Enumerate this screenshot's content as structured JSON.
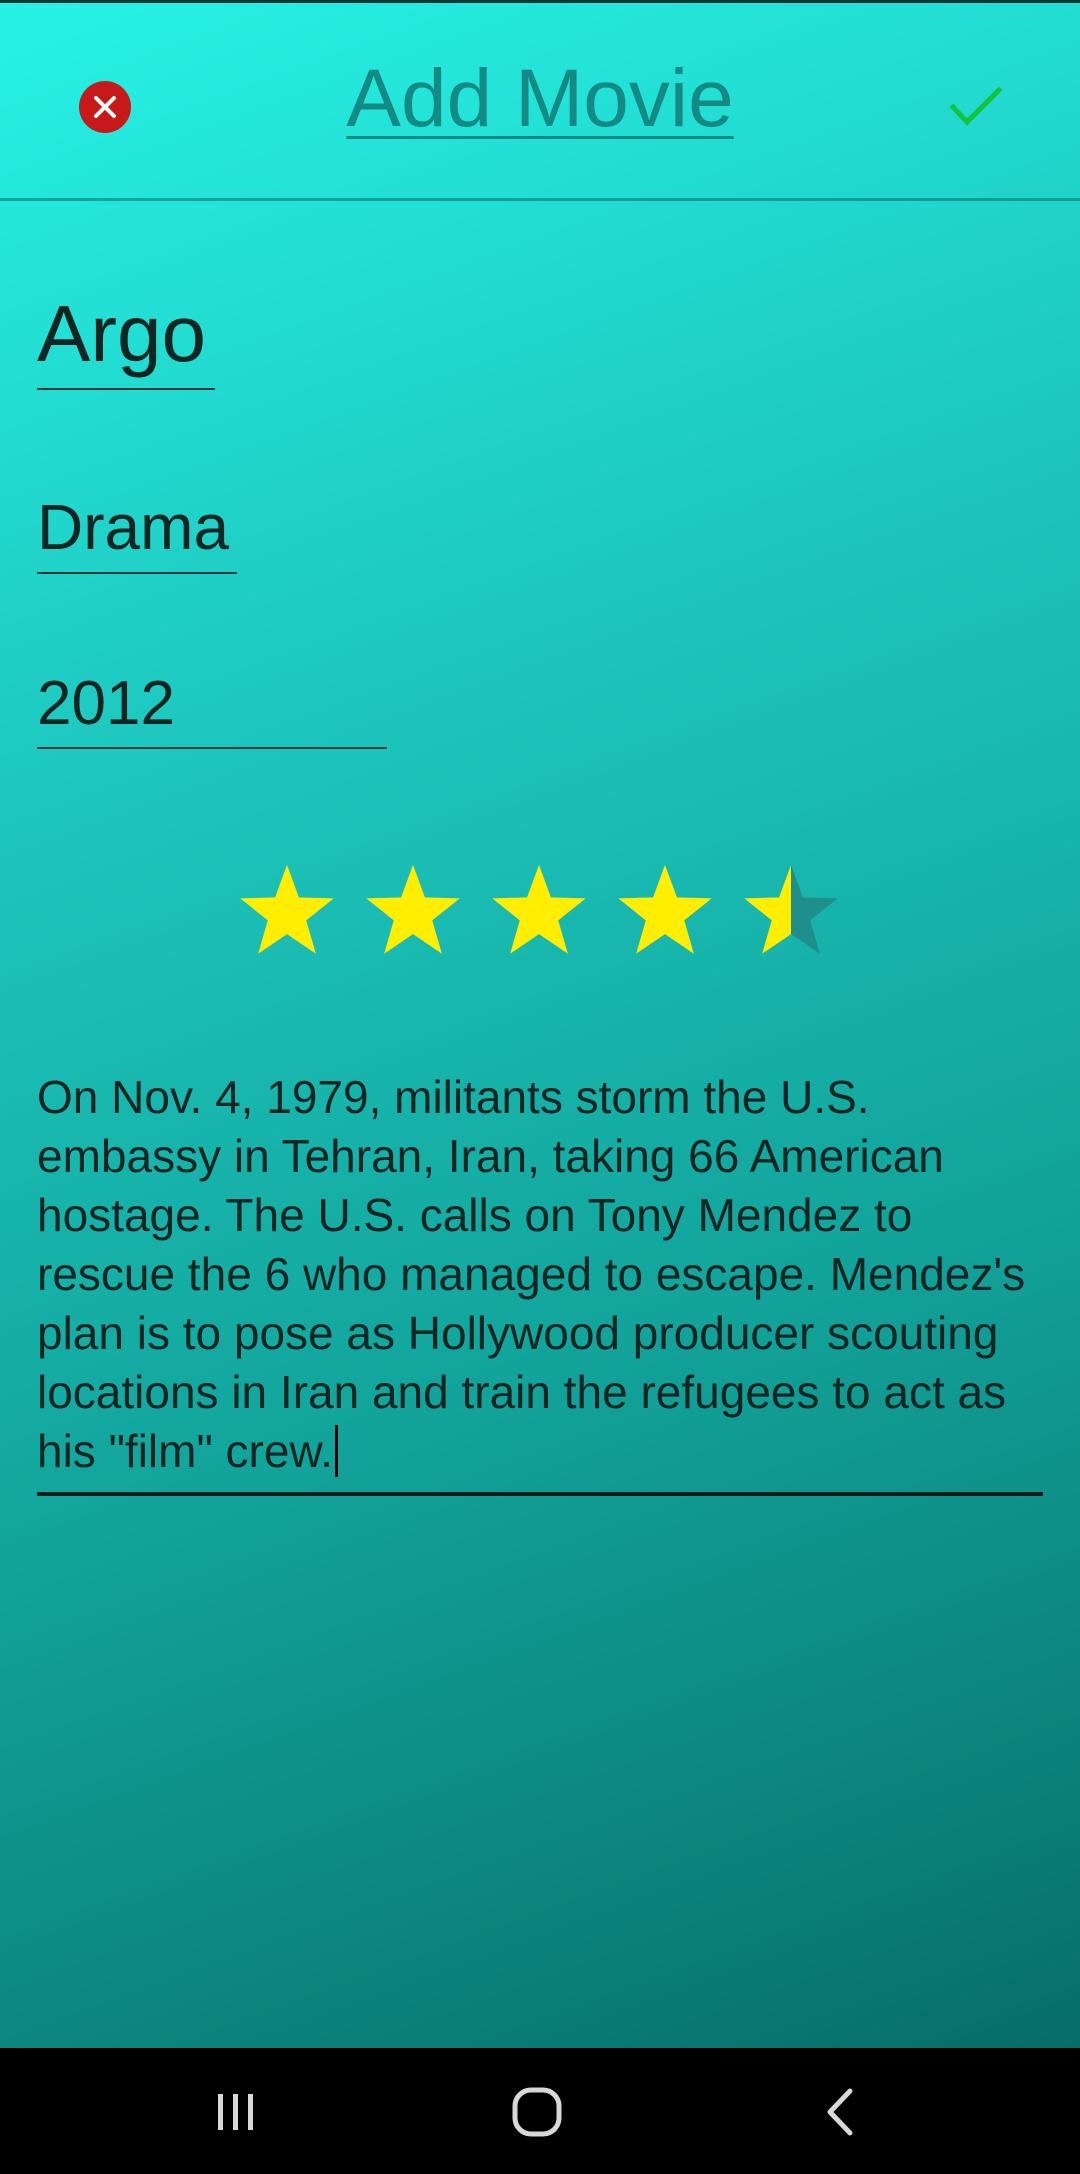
{
  "header": {
    "title": "Add Movie",
    "cancel_icon": "close-circle-icon",
    "confirm_icon": "check-icon"
  },
  "form": {
    "title_value": "Argo",
    "genre_value": "Drama",
    "year_value": "2012",
    "rating": {
      "value": 4.5,
      "max": 5
    },
    "description": "On Nov. 4, 1979, militants storm the U.S. embassy in Tehran, Iran, taking 66 American hostage. The U.S. calls on Tony Mendez to rescue the 6 who managed to escape. Mendez's plan is to pose as Hollywood producer scouting locations in Iran and train the refugees to act as his \"film\" crew."
  },
  "navbar": {
    "recent_icon": "recent-apps-icon",
    "home_icon": "home-icon",
    "back_icon": "back-icon"
  },
  "colors": {
    "star_filled": "#ffee00",
    "star_empty": "#1e8f8a",
    "cancel_red": "#c8191a",
    "confirm_green": "#13c43a",
    "title_teal": "#138a83"
  }
}
